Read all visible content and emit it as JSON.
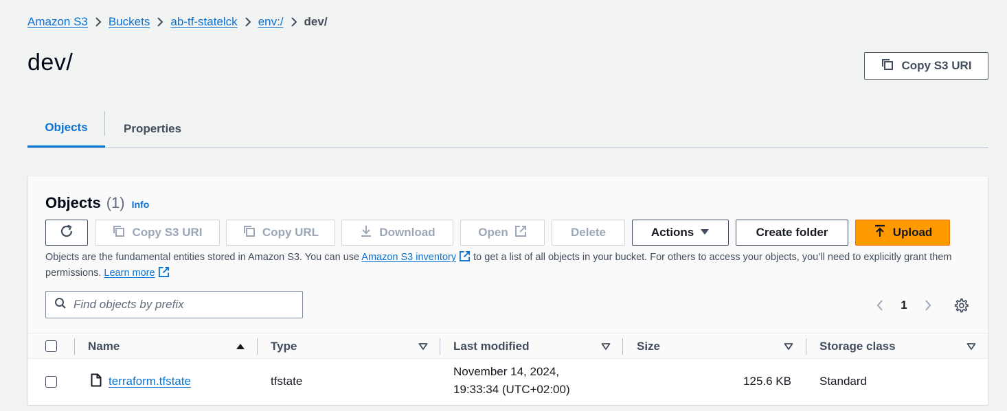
{
  "breadcrumb": {
    "items": [
      "Amazon S3",
      "Buckets",
      "ab-tf-statelck",
      "env:/"
    ],
    "current": "dev/"
  },
  "page": {
    "title": "dev/",
    "copy_uri_label": "Copy S3 URI"
  },
  "tabs": [
    {
      "label": "Objects",
      "active": true
    },
    {
      "label": "Properties",
      "active": false
    }
  ],
  "objects_panel": {
    "title": "Objects",
    "count": "(1)",
    "info_label": "Info",
    "toolbar": {
      "copy_s3_uri": "Copy S3 URI",
      "copy_url": "Copy URL",
      "download": "Download",
      "open": "Open",
      "delete": "Delete",
      "actions": "Actions",
      "create_folder": "Create folder",
      "upload": "Upload"
    },
    "description": {
      "part1": "Objects are the fundamental entities stored in Amazon S3. You can use ",
      "inventory_link": "Amazon S3 inventory",
      "part2": " to get a list of all objects in your bucket. For others to access your objects, you’ll need to explicitly grant them permissions. ",
      "learn_more": "Learn more"
    },
    "search": {
      "placeholder": "Find objects by prefix",
      "value": ""
    },
    "pagination": {
      "current_page": "1"
    },
    "columns": [
      "Name",
      "Type",
      "Last modified",
      "Size",
      "Storage class"
    ],
    "rows": [
      {
        "name": "terraform.tfstate",
        "type": "tfstate",
        "last_modified_line1": "November 14, 2024,",
        "last_modified_line2": "19:33:34 (UTC+02:00)",
        "size": "125.6 KB",
        "storage_class": "Standard"
      }
    ]
  },
  "colors": {
    "link": "#0972d3",
    "primary_button": "#ff9900",
    "background": "#f2f3f3"
  }
}
